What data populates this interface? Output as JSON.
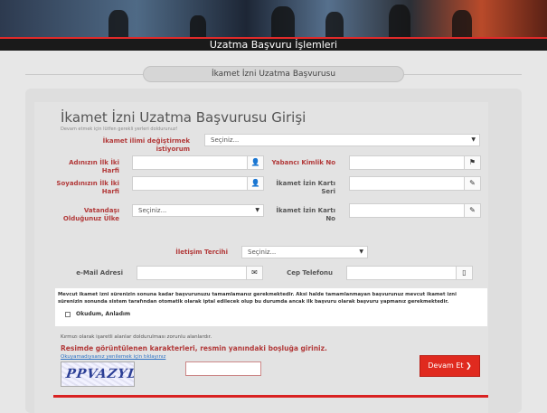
{
  "header": {
    "title": "Uzatma Başvuru İşlemleri"
  },
  "section_title": "İkamet İzni Uzatma Başvurusu",
  "form": {
    "heading": "İkamet İzni Uzatma Başvurusu Girişi",
    "hint": "Devam etmek için lütfen gerekli yerleri doldurunuz!",
    "fields": {
      "change_province_label": "İkamet ilimi değiştirmek istiyorum",
      "change_province_value": "Seçiniz...",
      "name_initials_label": "Adınızın İlk İki Harfi",
      "foreign_id_label": "Yabancı Kimlik No",
      "surname_initials_label_1": "Soyadınızın İlk İki",
      "surname_initials_label_2": "Harfi",
      "permit_serial_label_1": "İkamet İzin Kartı",
      "permit_serial_label_2": "Seri",
      "nationality_label_1": "Vatandaşı",
      "nationality_label_2": "Olduğunuz Ülke",
      "nationality_value": "Seçiniz...",
      "permit_no_label": "İkamet İzin Kartı No",
      "contact_pref_label": "İletişim Tercihi",
      "contact_pref_value": "Seçiniz...",
      "email_label": "e-Mail Adresi",
      "phone_label": "Cep Telefonu"
    },
    "notice": "Mevcut ikamet izni sürenizin sonuna kadar başvurunuzu tamamlamanız gerekmektedir. Aksi halde tamamlanmayan başvurunuz mevcut ikamet izni sürenizin sonunda sistem tarafından otomatik olarak iptal edilecek olup bu durumda ancak ilk başvuru olarak başvuru yapmanız gerekmektedir.",
    "checkbox_label": "Okudum, Anladım",
    "required_note": "Kırmızı olarak işaretli alanlar doldurulması zorunlu alanlardır.",
    "captcha_title": "Resimde görüntülenen karakterleri, resmin yanındaki boşluğa giriniz.",
    "captcha_link": "Okuyamadıysanız yenilemek için tıklayınız",
    "captcha_text": "PPVAZYDI",
    "submit_label": "Devam Et"
  },
  "icons": {
    "user": "user-icon",
    "flag": "flag-icon",
    "pencil": "pencil-icon",
    "envelope": "envelope-icon",
    "phone": "mobile-phone-icon",
    "chevron": "chevron-right-icon"
  },
  "colors": {
    "accent_red": "#e02a1f",
    "label_red": "#b23a3a",
    "link_blue": "#2d72c4"
  }
}
